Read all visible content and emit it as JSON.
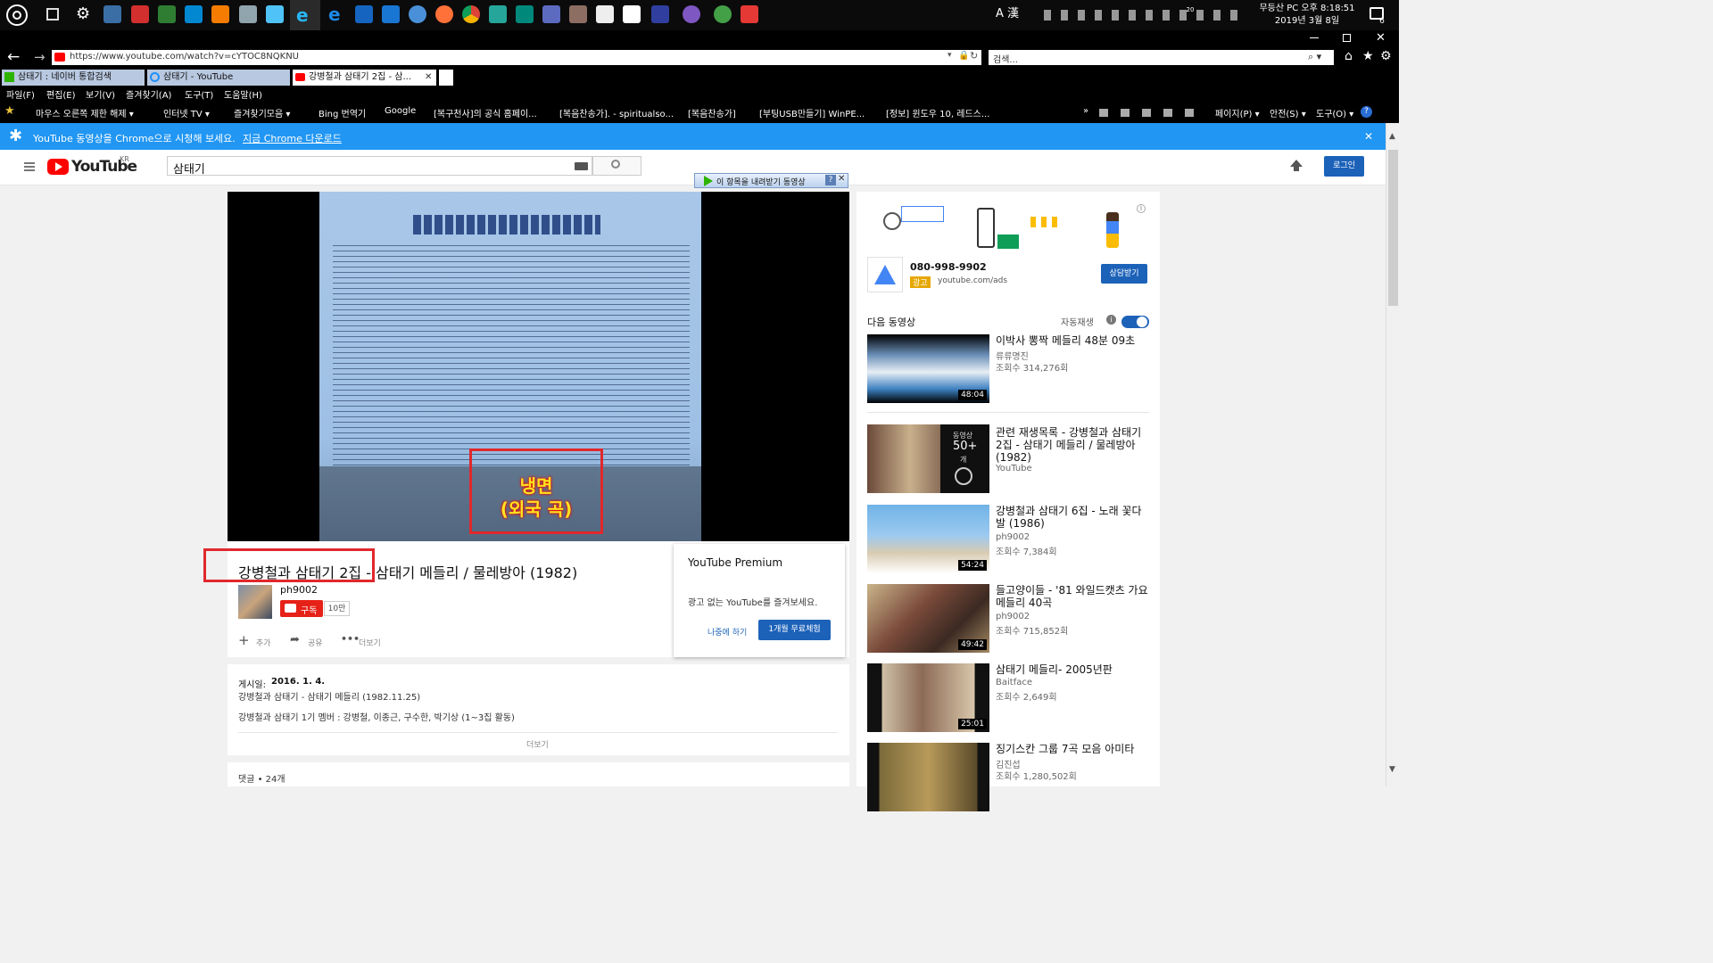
{
  "taskbar": {
    "clock_line1": "무등산 PC 오후 8:18:51",
    "clock_line2": "2019년 3월 8일",
    "ime": "A 漢",
    "notif_count": "6",
    "temp": "20"
  },
  "browser": {
    "url": "https://www.youtube.com/watch?v=cYTOC8NQKNU",
    "search_placeholder": "검색...",
    "tabs": [
      {
        "label": "삼태기 : 네이버 통합검색",
        "icon_color": "#2db400"
      },
      {
        "label": "삼태기 - YouTube",
        "icon_color": "#1e90ff"
      },
      {
        "label": "강병철과 삼태기 2집 - 삼...",
        "icon_color": "#ff0000"
      }
    ],
    "menu": [
      "파일(F)",
      "편집(E)",
      "보기(V)",
      "즐겨찾기(A)",
      "도구(T)",
      "도움말(H)"
    ],
    "favorites": [
      "마우스 오른쪽 제한 해제 ▾",
      "인터넷 TV ▾",
      "즐겨찾기모음 ▾",
      "Bing 번역기",
      "Google",
      "[복구천사]의 공식 홈페이...",
      "[복음찬송가]. - spiritualso...",
      "[복음찬송가]",
      "[부팅USB만들기] WinPE...",
      "[정보] 윈도우 10, 레드스..."
    ],
    "cmd_bar": [
      "페이지(P) ▾",
      "안전(S) ▾",
      "도구(O) ▾"
    ]
  },
  "banner": {
    "text": "YouTube 동영상을 Chrome으로 시청해 보세요.",
    "link": "지금 Chrome 다운로드"
  },
  "youtube": {
    "logo": "YouTube",
    "region": "KR",
    "search_value": "삼태기",
    "login": "로그인",
    "download_bar": "이 항목을 내려받기 동영상",
    "overlay_text_line1": "냉면",
    "overlay_text_line2": "(외국 곡)",
    "video_title": "강병철과 삼태기 2집 - 삼태기 메들리 / 물레방아 (1982)",
    "channel": "ph9002",
    "subscribe": "구독",
    "subscribers": "10만",
    "actions": [
      "추가",
      "공유",
      "더보기"
    ],
    "published_label": "게시일:",
    "published_date": "2016. 1. 4.",
    "desc_line1": "강병철과 삼태기 - 삼태기 메들리 (1982.11.25)",
    "desc_line2": "강병철과 삼태기 1기 멤버 : 강병철, 이종근, 구수한, 박기상 (1~3집 활동)",
    "show_more": "더보기",
    "comments": "댓글 • 24개",
    "premium": {
      "title": "YouTube Premium",
      "body": "광고 없는 YouTube를 즐겨보세요.",
      "later": "나중에 하기",
      "trial": "1개월 무료체험"
    },
    "ad": {
      "phone": "080-998-9902",
      "badge": "광고",
      "domain": "youtube.com/ads",
      "cta": "상담받기"
    },
    "up_next": "다음 동영상",
    "autoplay": "자동재생",
    "related": [
      {
        "title": "이박사 뽕짝 메들리 48분 09초",
        "channel": "류류명진",
        "views": "조회수 314,276회",
        "duration": "48:04"
      },
      {
        "title": "관련 재생목록 - 강병철과 삼태기 2집 - 삼태기 메들리 / 물레방아 (1982)",
        "channel": "YouTube",
        "views": "",
        "duration": "",
        "playlist_label": "동영상",
        "playlist_count": "50+",
        "playlist_unit": "개"
      },
      {
        "title": "강병철과 삼태기 6집 - 노래 꽃다발 (1986)",
        "channel": "ph9002",
        "views": "조회수 7,384회",
        "duration": "54:24"
      },
      {
        "title": "들고양이들 - '81 와일드캣츠 가요메들리 40곡",
        "channel": "ph9002",
        "views": "조회수 715,852회",
        "duration": "49:42"
      },
      {
        "title": "삼태기 메들리- 2005년판",
        "channel": "Baitface",
        "views": "조회수 2,649회",
        "duration": "25:01"
      },
      {
        "title": "징기스칸 그룹 7곡 모음 아미타",
        "channel": "김진섭",
        "views": "조회수 1,280,502회",
        "duration": ""
      }
    ]
  }
}
